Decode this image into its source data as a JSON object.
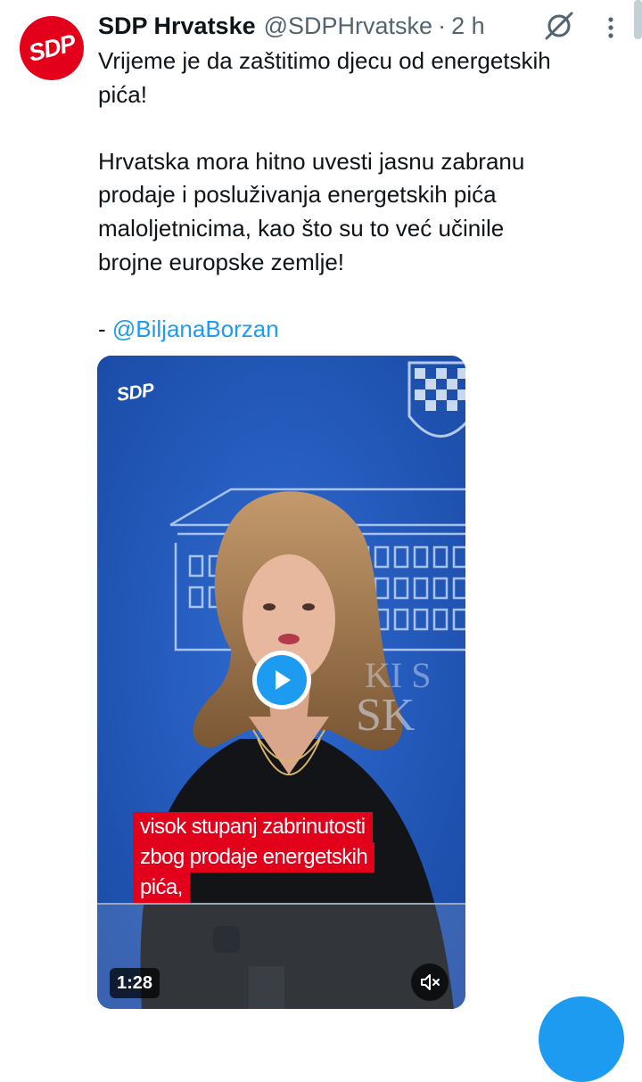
{
  "tweet": {
    "avatar_text": "SDP",
    "display_name": "SDP Hrvatske",
    "handle": "@SDPHrvatske",
    "separator": "·",
    "time": "2 h",
    "lines": [
      "Vrijeme je da zaštitimo djecu od energetskih",
      "pića!",
      "Hrvatska mora hitno uvesti jasnu zabranu",
      "prodaje i posluživanja energetskih pića",
      "maloljetnicima, kao što su to već učinile",
      "brojne europske zemlje!"
    ],
    "mention_prefix": "- ",
    "mention": "@BiljanaBorzan"
  },
  "video": {
    "logo": "SDP",
    "caption_lines": [
      "visok stupanj zabrinutosti",
      "zbog prodaje energetskih",
      "pića,"
    ],
    "duration": "1:28"
  },
  "colors": {
    "accent": "#1d9bf0",
    "brand_red": "#e2001a",
    "secondary_text": "#536471",
    "video_background": "#1f55b4"
  },
  "icons": [
    "grok-icon",
    "more-icon",
    "play-icon",
    "mute-icon"
  ]
}
